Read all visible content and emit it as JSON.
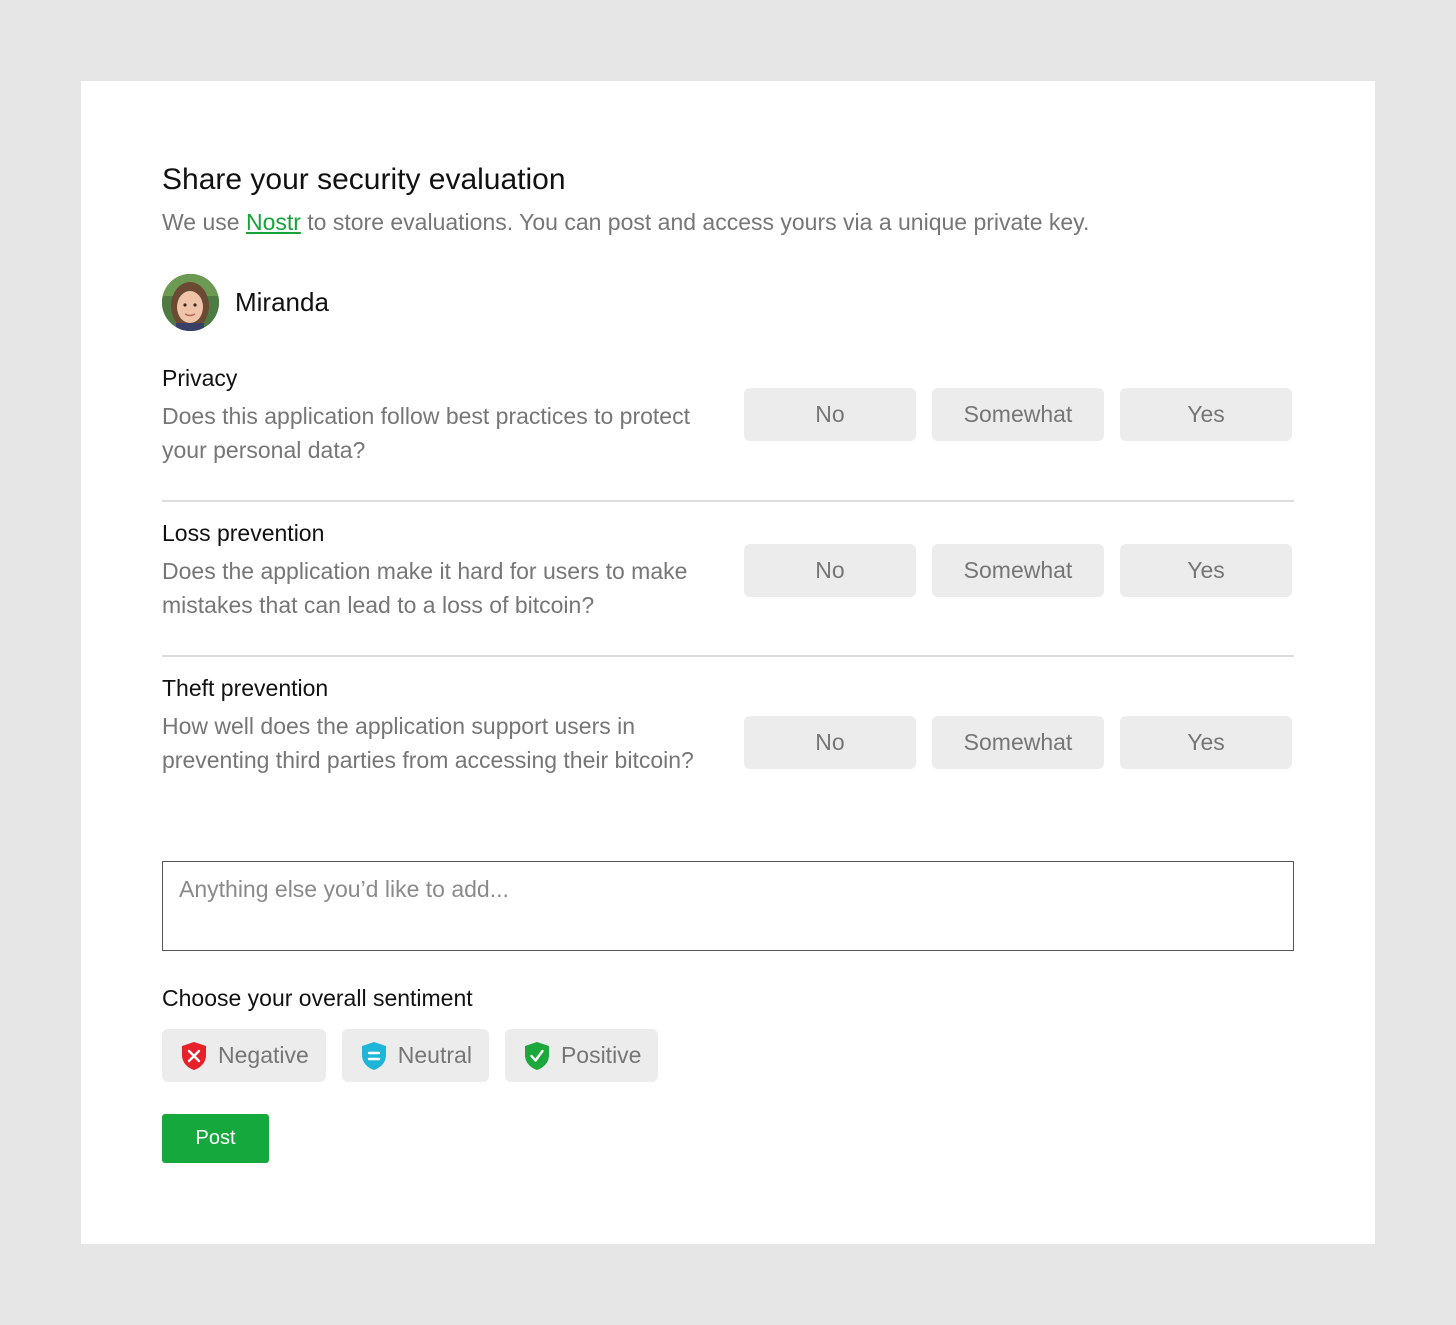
{
  "header": {
    "title": "Share your security evaluation",
    "subtitle_before": "We use ",
    "subtitle_link": "Nostr",
    "subtitle_after": " to store evaluations. You can post and access yours via a unique private key."
  },
  "user": {
    "name": "Miranda"
  },
  "questions": [
    {
      "title": "Privacy",
      "text": "Does this application follow best practices to protect your personal data?",
      "options": [
        "No",
        "Somewhat",
        "Yes"
      ]
    },
    {
      "title": "Loss prevention",
      "text": "Does the application make it hard for users to make mistakes that can lead to a loss of bitcoin?",
      "options": [
        "No",
        "Somewhat",
        "Yes"
      ]
    },
    {
      "title": "Theft prevention",
      "text": "How well does the application support users in preventing third parties from accessing their bitcoin?",
      "options": [
        "No",
        "Somewhat",
        "Yes"
      ]
    }
  ],
  "comment": {
    "placeholder": "Anything else you’d like to add..."
  },
  "sentiment": {
    "title": "Choose your overall sentiment",
    "options": [
      {
        "label": "Negative",
        "icon": "shield-x-icon",
        "color": "#e8202a"
      },
      {
        "label": "Neutral",
        "icon": "shield-equals-icon",
        "color": "#1fb5d8"
      },
      {
        "label": "Positive",
        "icon": "shield-check-icon",
        "color": "#1ca83d"
      }
    ]
  },
  "actions": {
    "post_label": "Post"
  },
  "colors": {
    "accent": "#15a83c",
    "link": "#17a33a",
    "option_bg": "#ececec",
    "page_bg": "#e6e6e6"
  }
}
